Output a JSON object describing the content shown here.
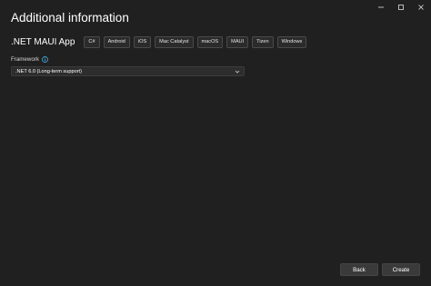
{
  "window": {
    "controls": {
      "minimize_icon": "minimize-icon",
      "maximize_icon": "maximize-icon",
      "close_icon": "close-icon"
    }
  },
  "dialog": {
    "title": "Additional information",
    "template_name": ".NET MAUI App",
    "tags": [
      "C#",
      "Android",
      "iOS",
      "Mac Catalyst",
      "macOS",
      "MAUI",
      "Tizen",
      "Windows"
    ]
  },
  "framework": {
    "label": "Framework",
    "info_icon": "info-icon",
    "selected": ".NET 6.0 (Long-term support)"
  },
  "footer": {
    "back_label": "Back",
    "create_label": "Create"
  },
  "colors": {
    "background": "#202020",
    "accent": "#4cc2ff"
  }
}
